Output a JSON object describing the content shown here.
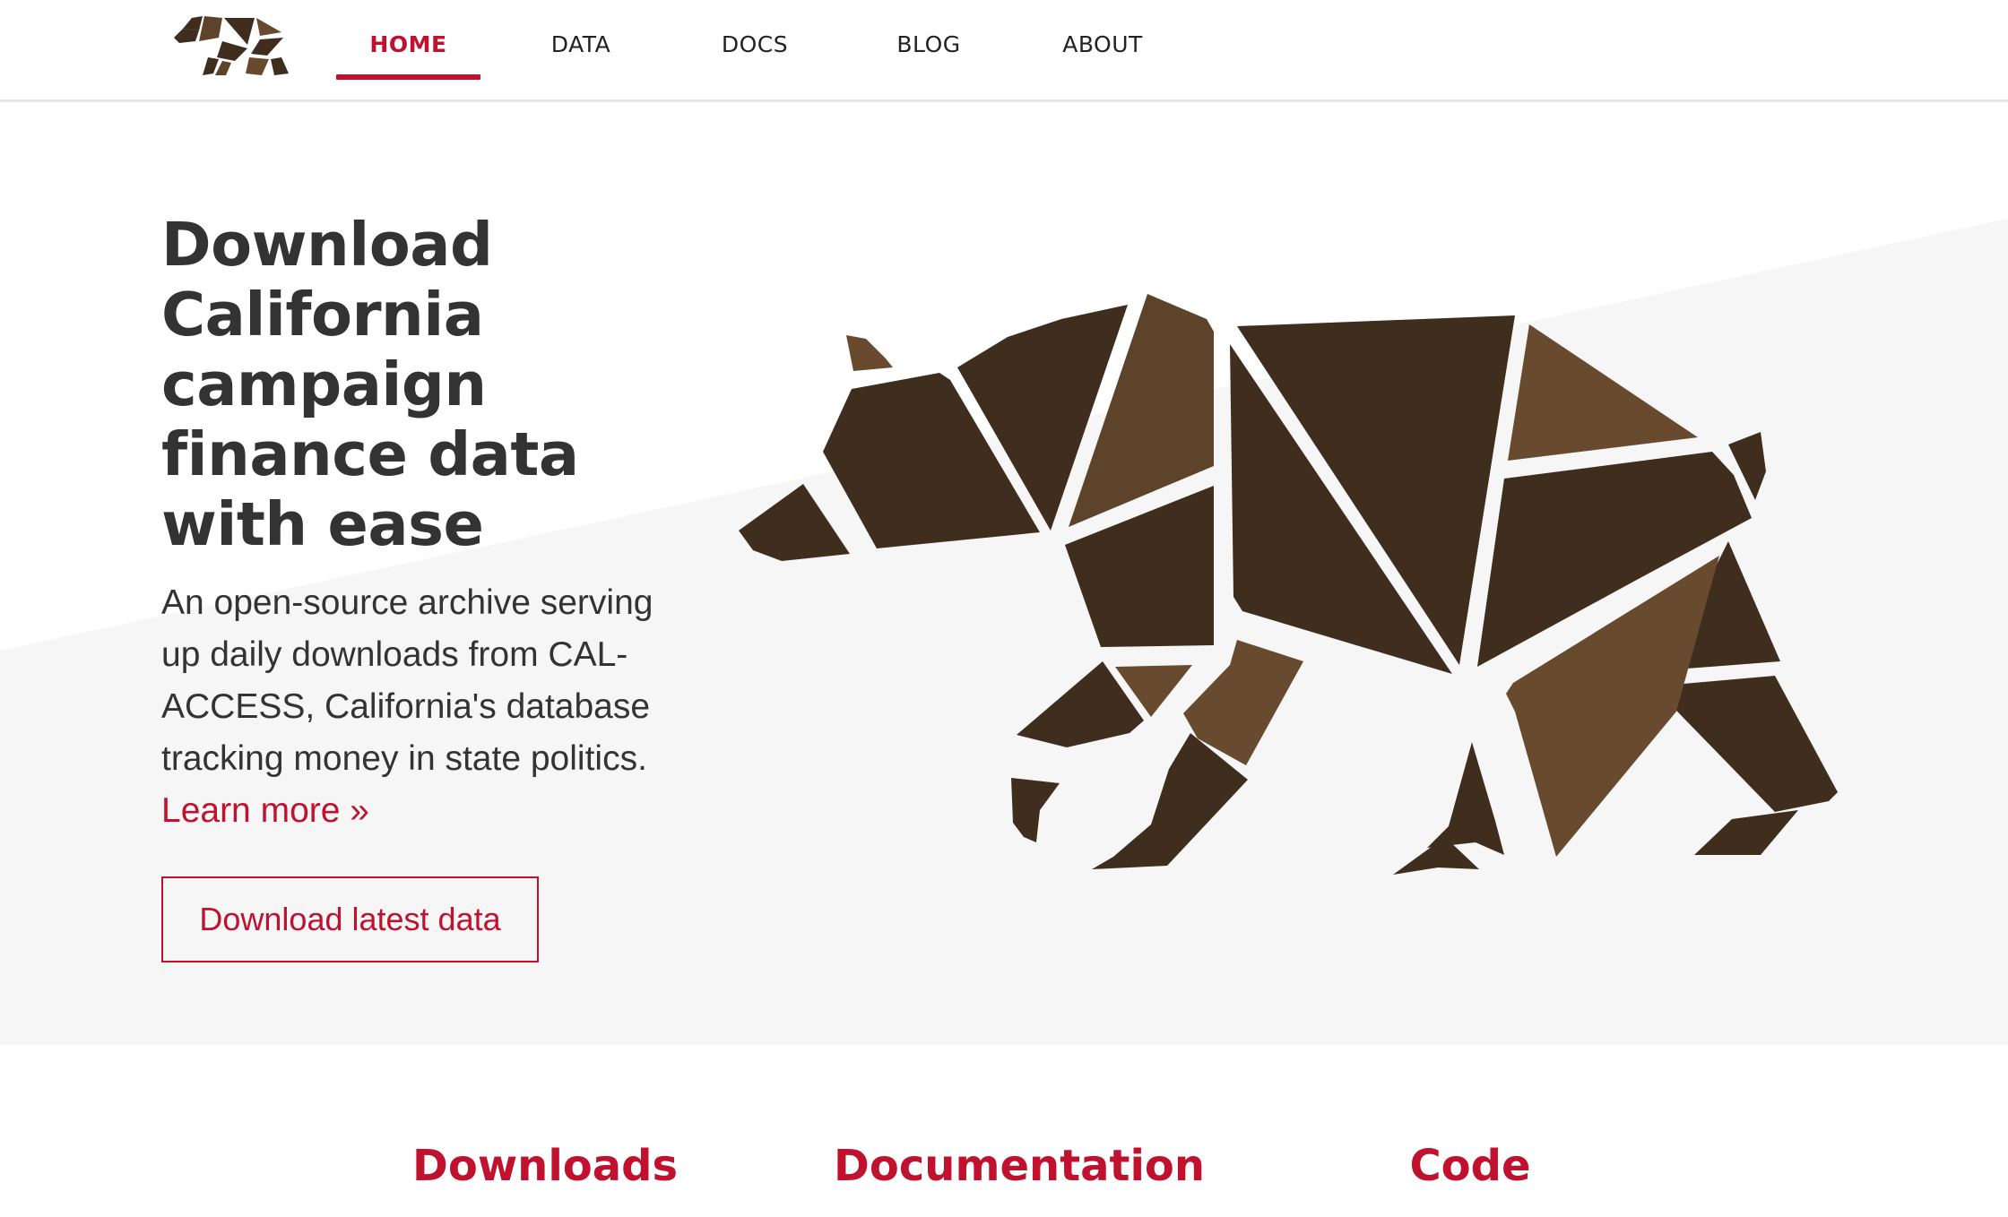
{
  "brand": {
    "logo_icon": "bear-logo-icon"
  },
  "colors": {
    "accent": "#c0112f",
    "bear_dark": "#3f2e1e",
    "bear_mid": "#5d4329",
    "bear_light": "#684b2f",
    "hero_band": "#f6f6f6"
  },
  "nav": {
    "items": [
      {
        "label": "HOME",
        "active": true
      },
      {
        "label": "DATA",
        "active": false
      },
      {
        "label": "DOCS",
        "active": false
      },
      {
        "label": "BLOG",
        "active": false
      },
      {
        "label": "ABOUT",
        "active": false
      }
    ]
  },
  "hero": {
    "headline": "Download California campaign finance data with ease",
    "description": "An open-source archive serving up daily downloads from CAL-ACCESS, California's database tracking money in state politics.",
    "learn_more": "Learn more »",
    "cta": "Download latest data",
    "illustration_icon": "geometric-bear-icon"
  },
  "features": [
    {
      "title": "Downloads"
    },
    {
      "title": "Documentation"
    },
    {
      "title": "Code"
    }
  ]
}
